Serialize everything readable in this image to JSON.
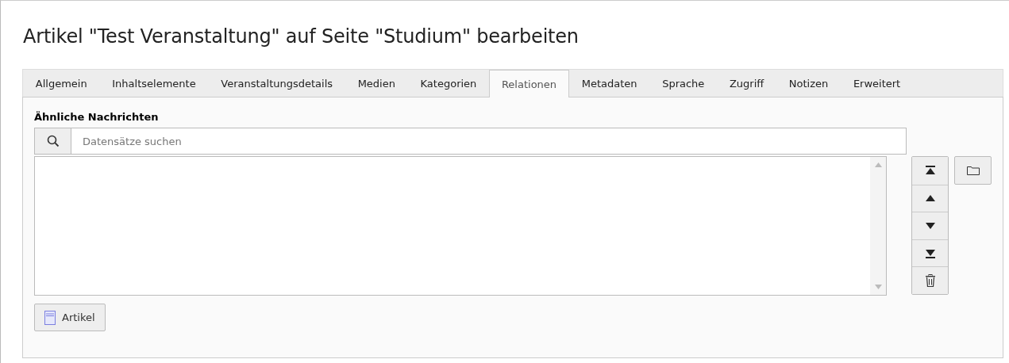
{
  "title": "Artikel \"Test Veranstaltung\" auf Seite \"Studium\" bearbeiten",
  "tabs": [
    {
      "label": "Allgemein",
      "selected": false
    },
    {
      "label": "Inhaltselemente",
      "selected": false
    },
    {
      "label": "Veranstaltungsdetails",
      "selected": false
    },
    {
      "label": "Medien",
      "selected": false
    },
    {
      "label": "Kategorien",
      "selected": false
    },
    {
      "label": "Relationen",
      "selected": true
    },
    {
      "label": "Metadaten",
      "selected": false
    },
    {
      "label": "Sprache",
      "selected": false
    },
    {
      "label": "Zugriff",
      "selected": false
    },
    {
      "label": "Notizen",
      "selected": false
    },
    {
      "label": "Erweitert",
      "selected": false
    }
  ],
  "field": {
    "label": "Ähnliche Nachrichten",
    "search": {
      "placeholder": "Datensätze suchen"
    },
    "add_button": "Artikel"
  }
}
